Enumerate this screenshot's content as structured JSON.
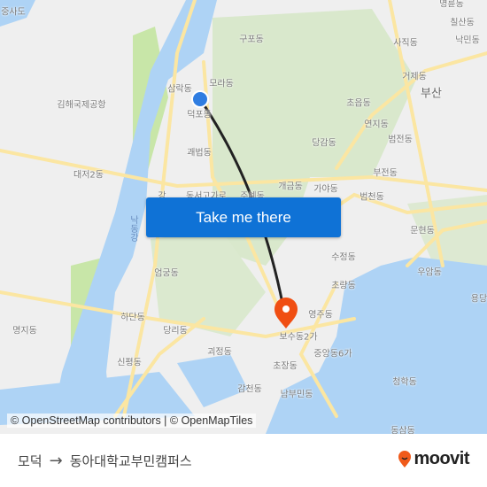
{
  "map": {
    "labels": {
      "jungsado": "중사도",
      "gimhae_airport": "김해국제공항",
      "samnak": "삼락동",
      "mora": "모라동",
      "deokpo": "덕포동",
      "gupo": "구포동",
      "gwaebeop": "괘법동",
      "daeji2": "대저2동",
      "dongseo_gogaro": "동서고가로",
      "jurye": "주례동",
      "gang": "강",
      "nakdonggang": "낙동강",
      "gaegeum": "개금동",
      "gaya": "가야동",
      "beomcheon": "범천동",
      "buam": "부전동",
      "beomjeon": "범전동",
      "yeonji": "연지동",
      "choeup": "초읍동",
      "geoje": "거제동",
      "busan": "부산",
      "sajik": "사직동",
      "nakmin": "낙민동",
      "chilsan": "칠산동",
      "myeongnyun": "명륜동",
      "dangam": "당감동",
      "munhyeon": "문현동",
      "sujeong": "수정동",
      "choryang": "초량동",
      "yeongju": "영주동",
      "bosu2ga": "보수동2가",
      "jungang6ga": "중앙동6가",
      "chojang": "초장동",
      "nambumin": "남부민동",
      "gamcheon": "감천동",
      "cheonghak": "청학동",
      "uam": "우암동",
      "yongdang": "용당",
      "eomgung": "엄궁동",
      "hadan": "하단동",
      "dangni": "당리동",
      "goejeong": "괴정동",
      "sinpyeong": "신평동",
      "myeongji": "명지동",
      "dongsam": "동삼동"
    },
    "attribution": "© OpenStreetMap contributors | © OpenMapTiles",
    "cta_label": "Take me there",
    "origin_color": "#2f7de1",
    "destination_color": "#f04e12",
    "route_color": "#222222"
  },
  "footer": {
    "origin": "모덕",
    "arrow": "→",
    "destination": "동아대학교부민캠퍼스",
    "logo_text": "moovit",
    "logo_color": "#f05a1a"
  }
}
